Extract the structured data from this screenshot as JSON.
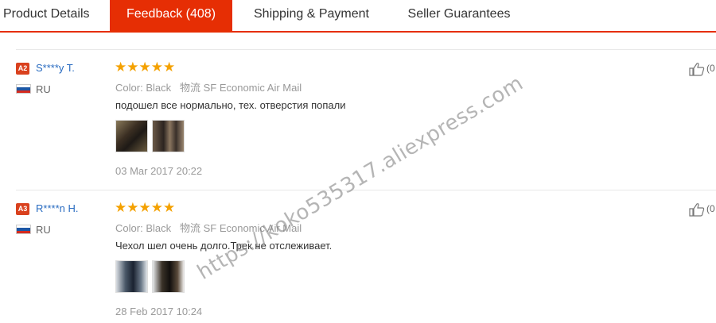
{
  "tabs": [
    {
      "label": "Product Details"
    },
    {
      "label": "Feedback (408)"
    },
    {
      "label": "Shipping & Payment"
    },
    {
      "label": "Seller Guarantees"
    }
  ],
  "accent_color": "#e62e04",
  "reviews": [
    {
      "badge": "A2",
      "name": "S****y T.",
      "country": "RU",
      "stars": "★★★★★",
      "color_label": "Color:",
      "color_value": "Black",
      "shipping_label": "物流",
      "shipping_value": "SF Economic Air Mail",
      "text": "подошел все нормально, тех. отверстия попали",
      "date": "03 Mar 2017 20:22",
      "like_count": "(0"
    },
    {
      "badge": "A3",
      "name": "R****n H.",
      "country": "RU",
      "stars": "★★★★★",
      "color_label": "Color:",
      "color_value": "Black",
      "shipping_label": "物流",
      "shipping_value": "SF Economic Air Mail",
      "text": "Чехол шел очень долго.Трек не отслеживает.",
      "date": "28 Feb 2017 10:24",
      "like_count": "(0"
    }
  ],
  "watermark": "https://koko535317.aliexpress.com"
}
